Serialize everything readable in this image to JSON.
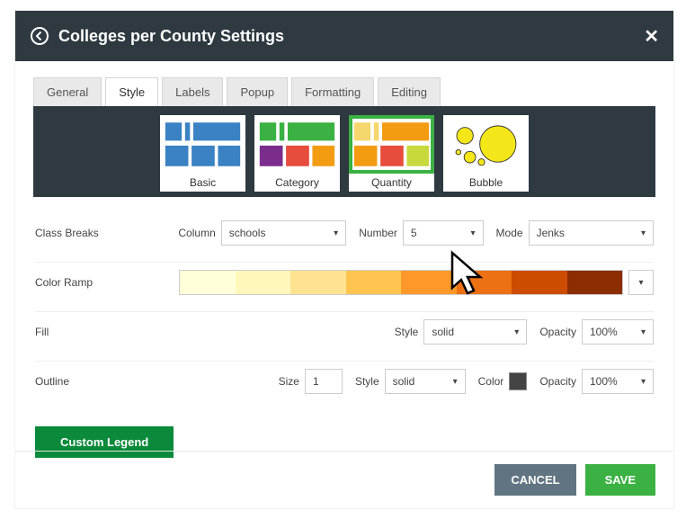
{
  "header": {
    "title": "Colleges per County Settings"
  },
  "tabs": [
    "General",
    "Style",
    "Labels",
    "Popup",
    "Formatting",
    "Editing"
  ],
  "active_tab": "Style",
  "style_types": [
    {
      "name": "Basic"
    },
    {
      "name": "Category"
    },
    {
      "name": "Quantity",
      "selected": true
    },
    {
      "name": "Bubble"
    }
  ],
  "class_breaks": {
    "row_label": "Class Breaks",
    "column_label": "Column",
    "column_value": "schools",
    "number_label": "Number",
    "number_value": "5",
    "mode_label": "Mode",
    "mode_value": "Jenks"
  },
  "color_ramp": {
    "row_label": "Color Ramp"
  },
  "fill": {
    "row_label": "Fill",
    "style_label": "Style",
    "style_value": "solid",
    "opacity_label": "Opacity",
    "opacity_value": "100%"
  },
  "outline": {
    "row_label": "Outline",
    "size_label": "Size",
    "size_value": "1",
    "style_label": "Style",
    "style_value": "solid",
    "color_label": "Color",
    "color_value": "#444444",
    "opacity_label": "Opacity",
    "opacity_value": "100%"
  },
  "buttons": {
    "custom_legend": "Custom Legend",
    "cancel": "CANCEL",
    "save": "SAVE"
  }
}
